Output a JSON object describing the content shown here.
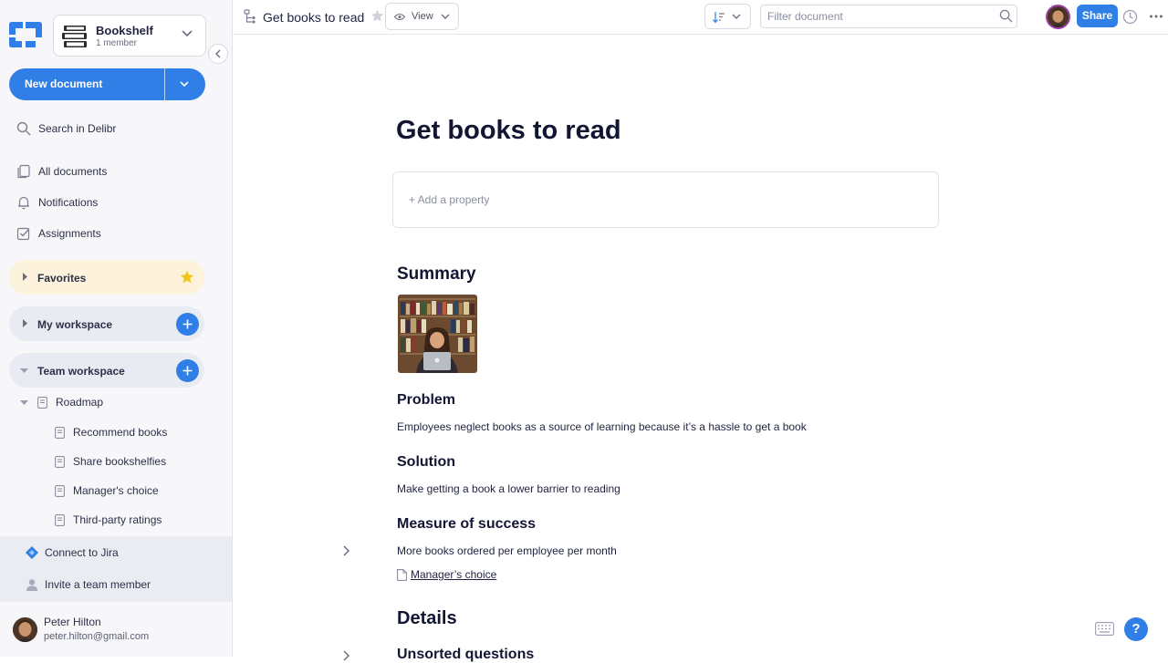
{
  "workspace": {
    "name": "Bookshelf",
    "members": "1 member"
  },
  "sidebar": {
    "new_document_label": "New document",
    "search_label": "Search in Delibr",
    "nav": [
      {
        "label": "All documents",
        "icon": "documents-icon"
      },
      {
        "label": "Notifications",
        "icon": "bell-icon"
      },
      {
        "label": "Assignments",
        "icon": "checkbox-icon"
      }
    ],
    "favorites_label": "Favorites",
    "my_workspace_label": "My workspace",
    "team_workspace_label": "Team workspace",
    "tree": {
      "root": "Roadmap",
      "children": [
        "Recommend books",
        "Share bookshelfies",
        "Manager's choice",
        "Third-party ratings"
      ]
    },
    "connect_jira_label": "Connect to Jira",
    "invite_label": "Invite a team member",
    "user": {
      "name": "Peter Hilton",
      "email": "peter.hilton@gmail.com"
    }
  },
  "topbar": {
    "doc_title": "Get books to read",
    "view_label": "View",
    "filter_placeholder": "Filter document",
    "share_label": "Share"
  },
  "document": {
    "title": "Get books to read",
    "add_property_label": "+ Add a property",
    "summary_heading": "Summary",
    "problem_heading": "Problem",
    "problem_text": "Employees neglect books as a source of learning because it’s a hassle to get a book",
    "solution_heading": "Solution",
    "solution_text": "Make getting a book a lower barrier to reading",
    "measure_heading": "Measure of success",
    "measure_text": "More books ordered per employee per month",
    "linked_doc": "Manager’s choice",
    "details_heading": "Details",
    "unsorted_heading": "Unsorted questions"
  },
  "help_label": "?",
  "colors": {
    "accent": "#2f7fe6",
    "favorites_bg": "#fdf3dc",
    "star": "#f5c518"
  }
}
